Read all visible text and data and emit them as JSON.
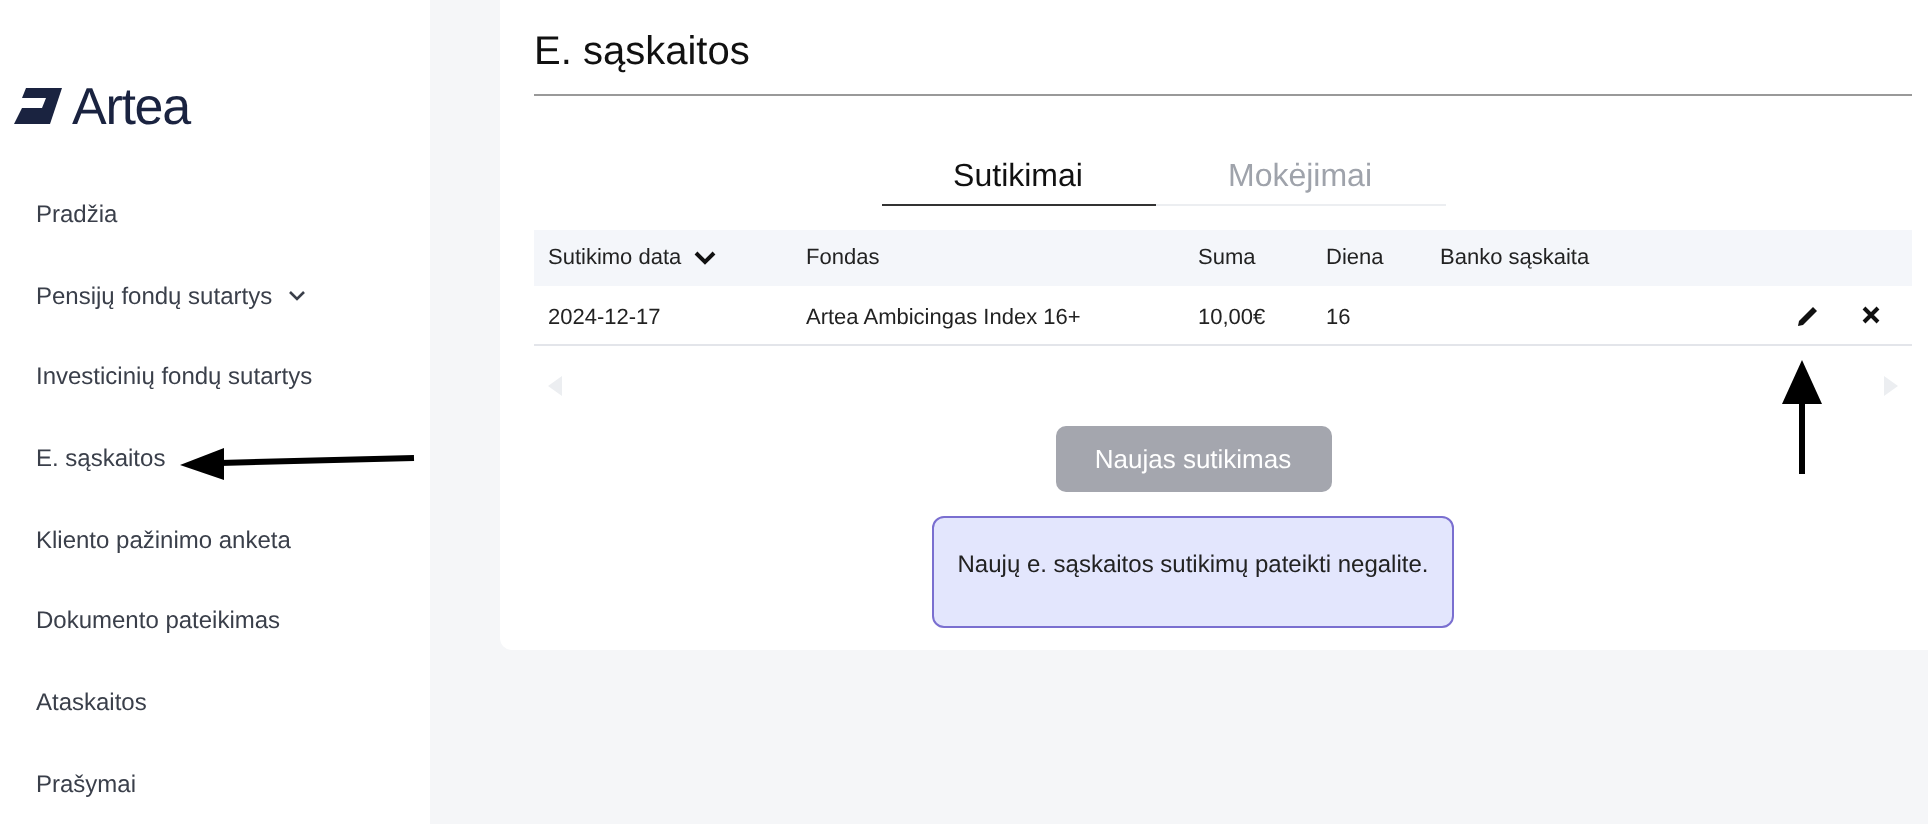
{
  "logo": {
    "text": "Artea"
  },
  "sidebar": {
    "items": [
      {
        "label": "Pradžia",
        "expandable": false
      },
      {
        "label": "Pensijų fondų sutartys",
        "expandable": true
      },
      {
        "label": "Investicinių fondų sutartys",
        "expandable": false
      },
      {
        "label": "E. sąskaitos",
        "expandable": false
      },
      {
        "label": "Kliento pažinimo anketa",
        "expandable": false
      },
      {
        "label": "Dokumento pateikimas",
        "expandable": false
      },
      {
        "label": "Ataskaitos",
        "expandable": false
      },
      {
        "label": "Prašymai",
        "expandable": false
      }
    ]
  },
  "page": {
    "title": "E. sąskaitos"
  },
  "tabs": [
    {
      "label": "Sutikimai",
      "selected": true
    },
    {
      "label": "Mokėjimai",
      "selected": false
    }
  ],
  "table": {
    "columns": [
      {
        "label": "Sutikimo data",
        "sorted": true
      },
      {
        "label": "Fondas",
        "sorted": false
      },
      {
        "label": "Suma",
        "sorted": false
      },
      {
        "label": "Diena",
        "sorted": false
      },
      {
        "label": "Banko sąskaita",
        "sorted": false
      }
    ],
    "rows": [
      {
        "cells": [
          "2024-12-17",
          "Artea Ambicingas Index 16+",
          "10,00€",
          "16",
          ""
        ]
      }
    ]
  },
  "new_button": {
    "label": "Naujas sutikimas",
    "disabled": true
  },
  "notice": {
    "text": "Naujų e. sąskaitos sutikimų pateikti negalite."
  }
}
